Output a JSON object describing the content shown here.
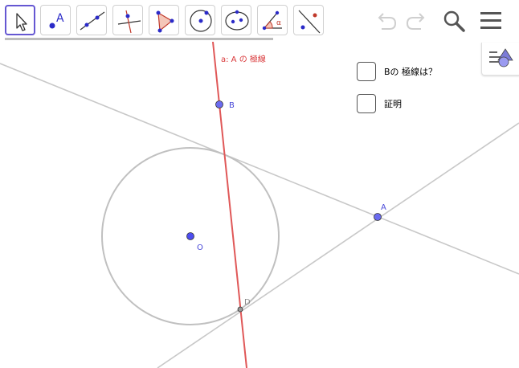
{
  "toolbar": {
    "tools": [
      {
        "name": "move-tool-icon",
        "selected": true
      },
      {
        "name": "point-tool-icon",
        "label": "A"
      },
      {
        "name": "line-tool-icon"
      },
      {
        "name": "perpendicular-line-tool-icon"
      },
      {
        "name": "polygon-tool-icon"
      },
      {
        "name": "circle-tool-icon"
      },
      {
        "name": "conic-tool-icon"
      },
      {
        "name": "angle-tool-icon",
        "label": "α"
      },
      {
        "name": "reflect-tool-icon"
      }
    ],
    "right": [
      "undo-icon",
      "redo-icon",
      "search-icon",
      "menu-icon"
    ]
  },
  "canvas": {
    "line_a_label": "a: A の 極線",
    "points": {
      "B": "B",
      "A": "A",
      "O": "O",
      "D": "D"
    }
  },
  "checkboxes": [
    {
      "label": "Bの 極線は？",
      "checked": false
    },
    {
      "label": "証明",
      "checked": false
    }
  ],
  "colors": {
    "accent": "#6557d2",
    "polar_line": "#e05858",
    "point_fill": "#4d4df0",
    "gray_line": "#c8c8c8",
    "label_blue": "#4a4ad8"
  }
}
